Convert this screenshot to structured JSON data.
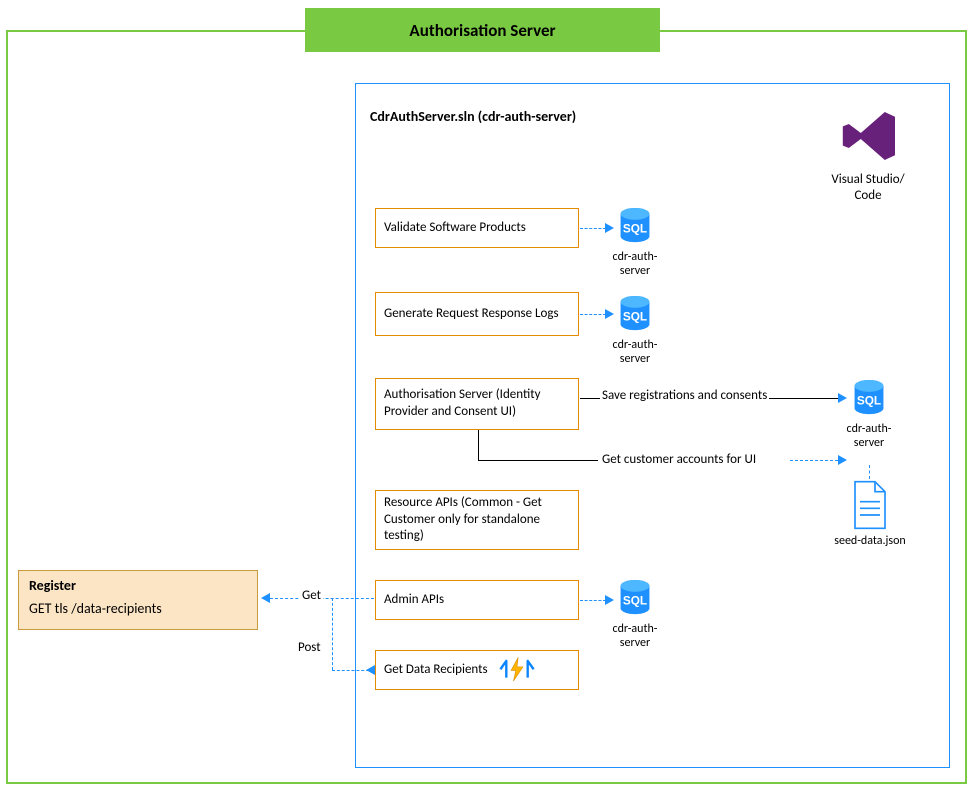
{
  "title": "Authorisation Server",
  "container": {
    "title": "CdrAuthServer.sln (cdr-auth-server)"
  },
  "ide": {
    "label": "Visual Studio/\nCode"
  },
  "boxes": {
    "validate": "Validate Software Products",
    "generate": "Generate Request Response Logs",
    "authsrv": "Authorisation Server (Identity Provider and Consent UI)",
    "resource": "Resource APIs (Common - Get Customer only for standalone testing)",
    "admin": "Admin APIs",
    "getdata": "Get Data Recipients"
  },
  "db_labels": {
    "validate": "cdr-auth-server",
    "generate": "cdr-auth-server",
    "authsrv": "cdr-auth-server",
    "admin": "cdr-auth-server"
  },
  "seed_file": "seed-data.json",
  "edge_labels": {
    "save": "Save registrations and consents",
    "getcust": "Get customer accounts for UI",
    "get": "Get",
    "post": "Post"
  },
  "register": {
    "title": "Register",
    "line1": "GET tls /data-recipients"
  }
}
